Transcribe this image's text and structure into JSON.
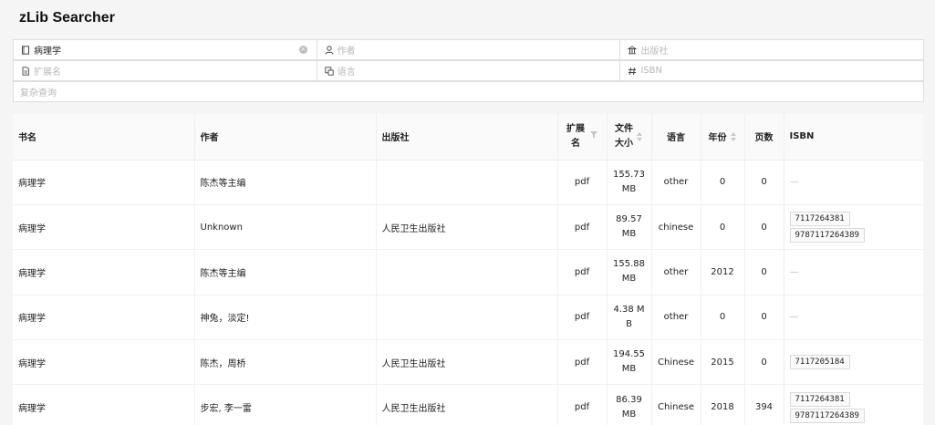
{
  "app": {
    "title": "zLib Searcher"
  },
  "search": {
    "title_value": "病理学",
    "author_placeholder": "作者",
    "publisher_placeholder": "出版社",
    "extension_placeholder": "扩展名",
    "language_placeholder": "语言",
    "isbn_placeholder": "ISBN",
    "complex_placeholder": "复杂查询"
  },
  "table": {
    "headers": {
      "title": "书名",
      "author": "作者",
      "publisher": "出版社",
      "extension_1": "扩展",
      "extension_2": "名",
      "filesize_1": "文件",
      "filesize_2": "大小",
      "language": "语言",
      "year": "年份",
      "pages": "页数",
      "isbn": "ISBN"
    },
    "rows": [
      {
        "title": "病理学",
        "author": "陈杰等主编",
        "publisher": "",
        "extension": "pdf",
        "size_1": "155.73",
        "size_2": "MB",
        "language": "other",
        "year": "0",
        "pages": "0",
        "isbn": []
      },
      {
        "title": "病理学",
        "author": "Unknown",
        "publisher": "人民卫生出版社",
        "extension": "pdf",
        "size_1": "89.57",
        "size_2": "MB",
        "language": "chinese",
        "year": "0",
        "pages": "0",
        "isbn": [
          "7117264381",
          "9787117264389"
        ]
      },
      {
        "title": "病理学",
        "author": "陈杰等主编",
        "publisher": "",
        "extension": "pdf",
        "size_1": "155.88",
        "size_2": "MB",
        "language": "other",
        "year": "2012",
        "pages": "0",
        "isbn": []
      },
      {
        "title": "病理学",
        "author": "神兔，淡定!",
        "publisher": "",
        "extension": "pdf",
        "size_1": "4.38 M",
        "size_2": "B",
        "language": "other",
        "year": "0",
        "pages": "0",
        "isbn": []
      },
      {
        "title": "病理学",
        "author": "陈杰，周桥",
        "publisher": "人民卫生出版社",
        "extension": "pdf",
        "size_1": "194.55",
        "size_2": "MB",
        "language": "Chinese",
        "year": "2015",
        "pages": "0",
        "isbn": [
          "7117205184"
        ]
      },
      {
        "title": "病理学",
        "author": "步宏, 李一雷",
        "publisher": "人民卫生出版社",
        "extension": "pdf",
        "size_1": "86.39",
        "size_2": "MB",
        "language": "Chinese",
        "year": "2018",
        "pages": "394",
        "isbn": [
          "7117264381",
          "9787117264389"
        ]
      }
    ]
  },
  "icons": {
    "title": "book-icon",
    "author": "user-icon",
    "publisher": "bank-icon",
    "extension": "file-icon",
    "language": "translate-icon",
    "isbn": "number-icon"
  }
}
